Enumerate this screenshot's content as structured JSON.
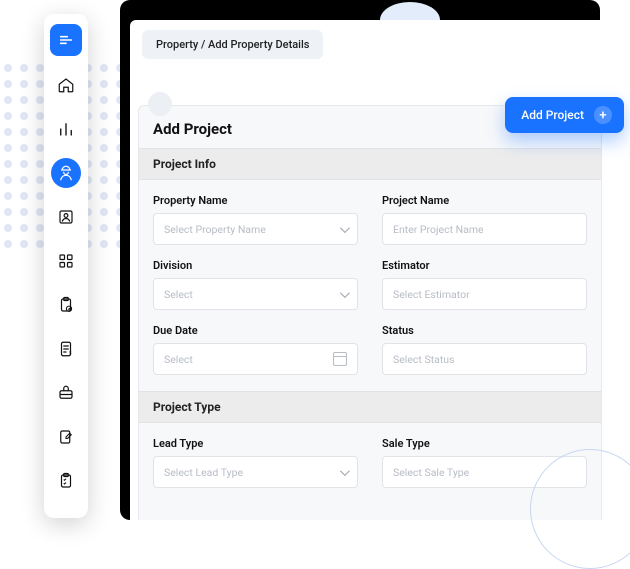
{
  "breadcrumb": "Property / Add Property Details",
  "page_title": "Add Project",
  "add_button_label": "Add Project",
  "sections": {
    "info": {
      "title": "Project Info",
      "fields": {
        "property_name": {
          "label": "Property Name",
          "placeholder": "Select Property Name"
        },
        "project_name": {
          "label": "Project Name",
          "placeholder": "Enter Project Name"
        },
        "division": {
          "label": "Division",
          "placeholder": "Select"
        },
        "estimator": {
          "label": "Estimator",
          "placeholder": "Select Estimator"
        },
        "due_date": {
          "label": "Due Date",
          "placeholder": "Select"
        },
        "status": {
          "label": "Status",
          "placeholder": "Select Status"
        }
      }
    },
    "type": {
      "title": "Project Type",
      "fields": {
        "lead_type": {
          "label": "Lead Type",
          "placeholder": "Select Lead Type"
        },
        "sale_type": {
          "label": "Sale Type",
          "placeholder": "Select Sale Type"
        }
      }
    }
  },
  "sidebar": {
    "items": [
      {
        "name": "brand",
        "icon": "menu-icon"
      },
      {
        "name": "home",
        "icon": "home-icon"
      },
      {
        "name": "reports",
        "icon": "bar-chart-icon"
      },
      {
        "name": "workers",
        "icon": "worker-icon",
        "active": true
      },
      {
        "name": "contacts",
        "icon": "contact-icon"
      },
      {
        "name": "apps",
        "icon": "grid-icon"
      },
      {
        "name": "tasks",
        "icon": "clipboard-check-icon"
      },
      {
        "name": "invoices",
        "icon": "invoice-icon"
      },
      {
        "name": "tools",
        "icon": "toolbox-icon"
      },
      {
        "name": "edit",
        "icon": "note-edit-icon"
      },
      {
        "name": "checklist",
        "icon": "clipboard-list-icon"
      }
    ]
  },
  "colors": {
    "accent": "#1a73ff"
  }
}
